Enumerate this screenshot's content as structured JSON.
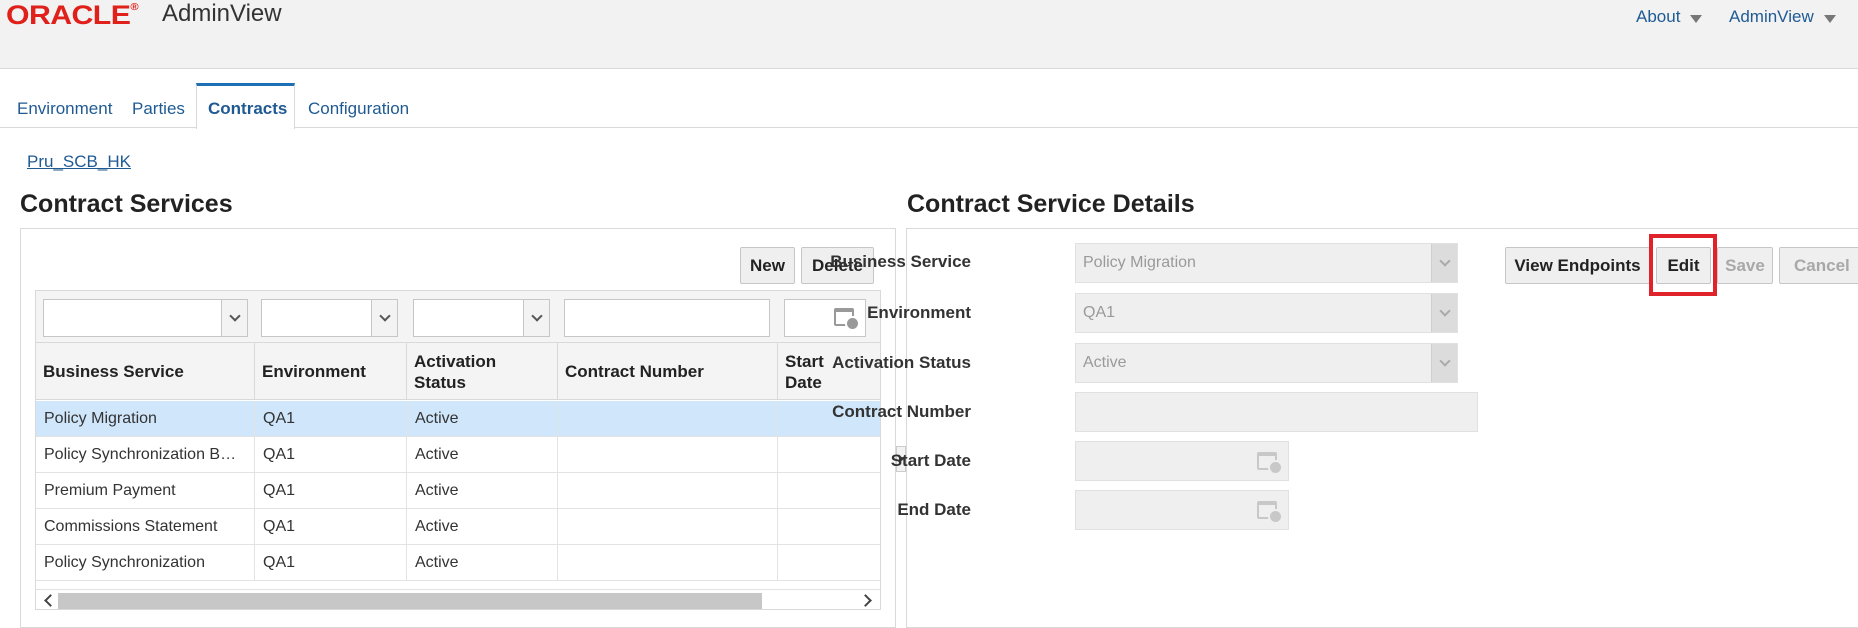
{
  "header": {
    "logo_text": "ORACLE",
    "app_title": "AdminView",
    "menu_about": "About",
    "menu_user": "AdminView"
  },
  "tabs": [
    {
      "label": "Environment"
    },
    {
      "label": "Parties"
    },
    {
      "label": "Contracts",
      "active": true
    },
    {
      "label": "Configuration"
    }
  ],
  "breadcrumb": "Pru_SCB_HK",
  "contract_services": {
    "title": "Contract Services",
    "new_label": "New",
    "delete_label": "Delete",
    "columns": [
      "Business Service",
      "Environment",
      "Activation Status",
      "Contract Number",
      "Start Date"
    ],
    "column_header_lines": [
      [
        "Business Service"
      ],
      [
        "Environment"
      ],
      [
        "Activation",
        "Status"
      ],
      [
        "Contract Number"
      ],
      [
        "Start",
        "Date"
      ]
    ],
    "rows": [
      {
        "business_service": "Policy Migration",
        "environment": "QA1",
        "status": "Active",
        "contract_number": "",
        "start_date": "",
        "selected": true
      },
      {
        "business_service": "Policy Synchronization B…",
        "environment": "QA1",
        "status": "Active",
        "contract_number": "",
        "start_date": ""
      },
      {
        "business_service": "Premium Payment",
        "environment": "QA1",
        "status": "Active",
        "contract_number": "",
        "start_date": ""
      },
      {
        "business_service": "Commissions Statement",
        "environment": "QA1",
        "status": "Active",
        "contract_number": "",
        "start_date": ""
      },
      {
        "business_service": "Policy Synchronization",
        "environment": "QA1",
        "status": "Active",
        "contract_number": "",
        "start_date": ""
      }
    ]
  },
  "details": {
    "title": "Contract Service Details",
    "view_endpoints_label": "View Endpoints",
    "edit_label": "Edit",
    "save_label": "Save",
    "cancel_label": "Cancel",
    "labels": {
      "business_service": "Business Service",
      "environment": "Environment",
      "activation_status": "Activation Status",
      "contract_number": "Contract Number",
      "start_date": "Start Date",
      "end_date": "End Date"
    },
    "values": {
      "business_service": "Policy Migration",
      "environment": "QA1",
      "activation_status": "Active",
      "contract_number": "",
      "start_date": "",
      "end_date": ""
    }
  },
  "colors": {
    "brand_red": "#e0201b",
    "link_blue": "#1f5a93",
    "selected_row": "#cfe6fb",
    "highlight_red": "#e0222a"
  }
}
